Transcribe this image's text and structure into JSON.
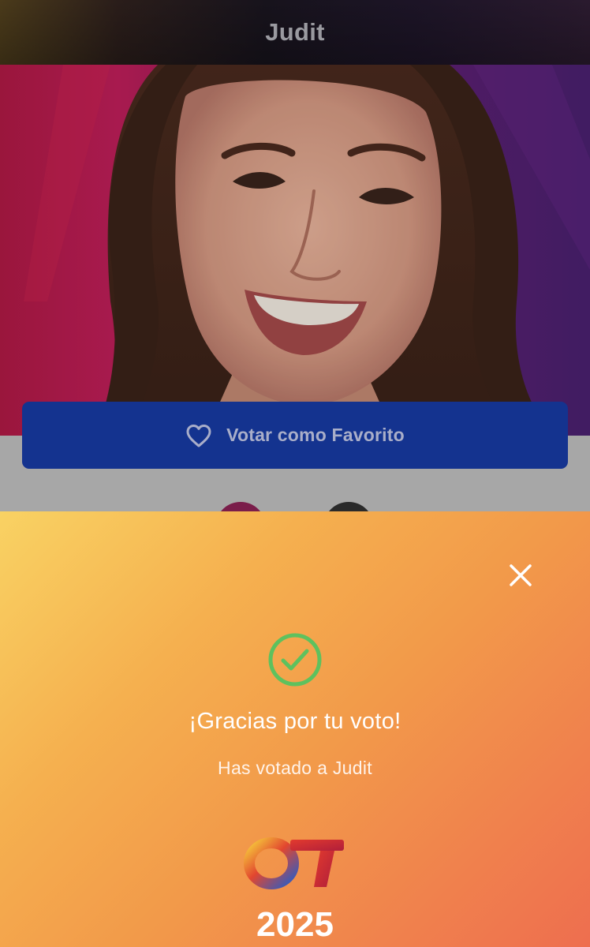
{
  "header": {
    "title": "Judit"
  },
  "vote_button": {
    "label": "Votar como Favorito",
    "icon": "heart-outline-icon",
    "color": "#14338f"
  },
  "confirmation": {
    "title": "¡Gracias por tu voto!",
    "subtitle": "Has votado a Judit",
    "check_icon": "check-circle-icon",
    "check_color": "#5ec15e",
    "close_icon": "close-icon"
  },
  "logo": {
    "letters": "OT",
    "year": "2025"
  }
}
